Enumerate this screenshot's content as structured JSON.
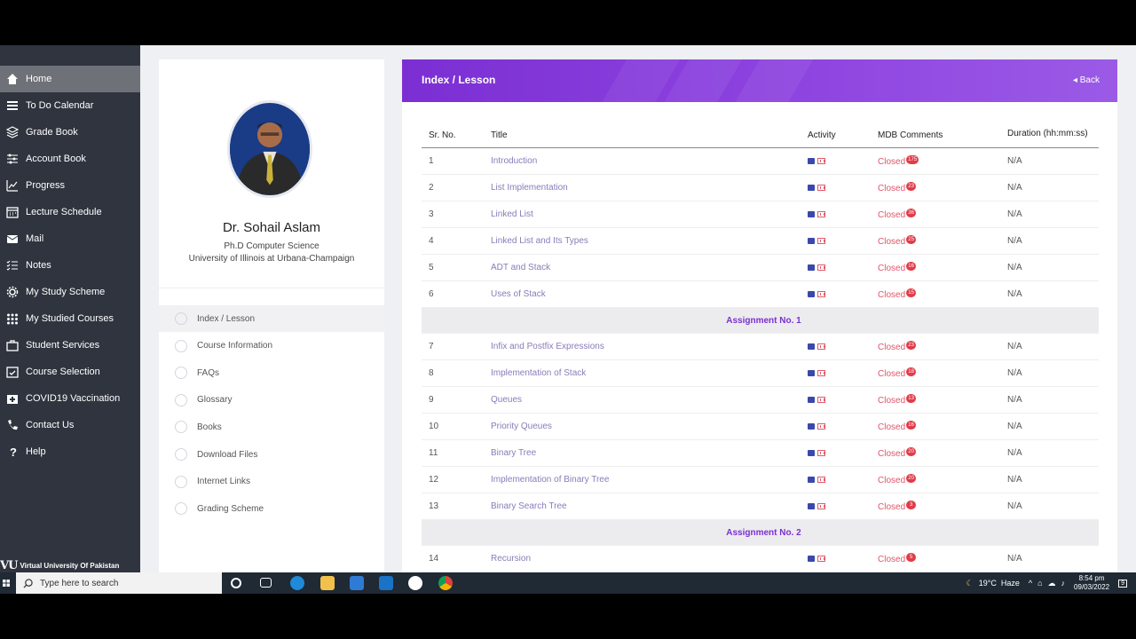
{
  "sidebar": {
    "items": [
      {
        "label": "Home",
        "icon": "home-icon"
      },
      {
        "label": "To Do Calendar",
        "icon": "list-icon"
      },
      {
        "label": "Grade Book",
        "icon": "layers-icon"
      },
      {
        "label": "Account Book",
        "icon": "sliders-icon"
      },
      {
        "label": "Progress",
        "icon": "chart-icon"
      },
      {
        "label": "Lecture Schedule",
        "icon": "calendar-icon"
      },
      {
        "label": "Mail",
        "icon": "mail-icon"
      },
      {
        "label": "Notes",
        "icon": "checklist-icon"
      },
      {
        "label": "My Study Scheme",
        "icon": "gear-icon"
      },
      {
        "label": "My Studied Courses",
        "icon": "grid-icon"
      },
      {
        "label": "Student Services",
        "icon": "briefcase-icon"
      },
      {
        "label": "Course Selection",
        "icon": "calendar-check-icon"
      },
      {
        "label": "COVID19 Vaccination",
        "icon": "medical-kit-icon"
      },
      {
        "label": "Contact Us",
        "icon": "phone-icon"
      },
      {
        "label": "Help",
        "icon": "question-icon"
      }
    ],
    "footer": {
      "logo": "VU",
      "text": "Virtual University Of Pakistan"
    }
  },
  "profile": {
    "name": "Dr. Sohail Aslam",
    "degree": "Ph.D Computer Science",
    "university": "University of Illinois at Urbana-Champaign",
    "menu": [
      {
        "label": "Index / Lesson"
      },
      {
        "label": "Course Information"
      },
      {
        "label": "FAQs"
      },
      {
        "label": "Glossary"
      },
      {
        "label": "Books"
      },
      {
        "label": "Download Files"
      },
      {
        "label": "Internet Links"
      },
      {
        "label": "Grading Scheme"
      }
    ]
  },
  "main": {
    "title": "Index / Lesson",
    "back": "◂ Back",
    "columns": [
      "Sr. No.",
      "Title",
      "Activity",
      "MDB Comments",
      "Duration (hh:mm:ss)"
    ],
    "rows": [
      {
        "no": "1",
        "title": "Introduction",
        "status": "Closed",
        "count": "175",
        "duration": "N/A"
      },
      {
        "no": "2",
        "title": "List Implementation",
        "status": "Closed",
        "count": "23",
        "duration": "N/A"
      },
      {
        "no": "3",
        "title": "Linked List",
        "status": "Closed",
        "count": "36",
        "duration": "N/A"
      },
      {
        "no": "4",
        "title": "Linked List and Its Types",
        "status": "Closed",
        "count": "25",
        "duration": "N/A"
      },
      {
        "no": "5",
        "title": "ADT and Stack",
        "status": "Closed",
        "count": "16",
        "duration": "N/A"
      },
      {
        "no": "6",
        "title": "Uses of Stack",
        "status": "Closed",
        "count": "15",
        "duration": "N/A"
      },
      {
        "assignment": "Assignment No. 1"
      },
      {
        "no": "7",
        "title": "Infix and Postfix Expressions",
        "status": "Closed",
        "count": "23",
        "duration": "N/A"
      },
      {
        "no": "8",
        "title": "Implementation of Stack",
        "status": "Closed",
        "count": "18",
        "duration": "N/A"
      },
      {
        "no": "9",
        "title": "Queues",
        "status": "Closed",
        "count": "13",
        "duration": "N/A"
      },
      {
        "no": "10",
        "title": "Priority Queues",
        "status": "Closed",
        "count": "16",
        "duration": "N/A"
      },
      {
        "no": "11",
        "title": "Binary Tree",
        "status": "Closed",
        "count": "20",
        "duration": "N/A"
      },
      {
        "no": "12",
        "title": "Implementation of Binary Tree",
        "status": "Closed",
        "count": "20",
        "duration": "N/A"
      },
      {
        "no": "13",
        "title": "Binary Search Tree",
        "status": "Closed",
        "count": "3",
        "duration": "N/A"
      },
      {
        "assignment": "Assignment No. 2"
      },
      {
        "no": "14",
        "title": "Recursion",
        "status": "Closed",
        "count": "5",
        "duration": "N/A"
      }
    ]
  },
  "taskbar": {
    "search_placeholder": "Type here to search",
    "weather": "19°C  Haze",
    "time": "8:54 pm",
    "date": "09/03/2022",
    "notifications": "9"
  },
  "colors": {
    "accent": "#7b2fd3",
    "sidebar": "#2f343f",
    "closed": "#e0566a"
  }
}
